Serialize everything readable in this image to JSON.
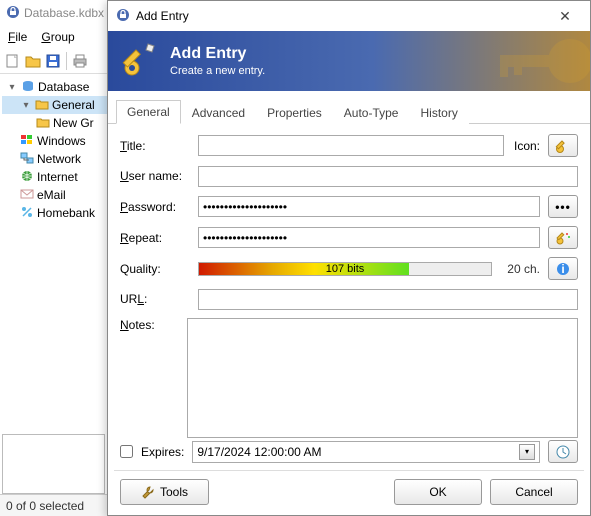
{
  "main": {
    "title": "Database.kdbx",
    "menu": {
      "file": "File",
      "group": "Group"
    },
    "tree": {
      "root": "Database",
      "general": "General",
      "newgroup": "New Gr",
      "items": [
        "Windows",
        "Network",
        "Internet",
        "eMail",
        "Homebank"
      ]
    },
    "status": "0 of 0 selected"
  },
  "dialog": {
    "title": "Add Entry",
    "header_title": "Add Entry",
    "header_sub": "Create a new entry.",
    "tabs": [
      "General",
      "Advanced",
      "Properties",
      "Auto-Type",
      "History"
    ],
    "labels": {
      "title": "Title:",
      "icon": "Icon:",
      "username": "User name:",
      "password": "Password:",
      "repeat": "Repeat:",
      "quality": "Quality:",
      "url": "URL:",
      "notes": "Notes:",
      "expires": "Expires:"
    },
    "values": {
      "title": "",
      "username": "",
      "password": "••••••••••••••••••••",
      "repeat": "••••••••••••••••••••",
      "url": "",
      "notes": "",
      "expires": "9/17/2024 12:00:00 AM"
    },
    "quality": {
      "bits": "107 bits",
      "chars": "20 ch."
    },
    "buttons": {
      "tools": "Tools",
      "ok": "OK",
      "cancel": "Cancel"
    }
  }
}
